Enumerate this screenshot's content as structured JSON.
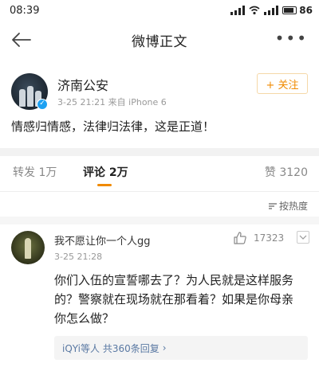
{
  "status_bar": {
    "time": "08:39",
    "battery": "86"
  },
  "nav": {
    "title": "微博正文"
  },
  "post": {
    "author": "济南公安",
    "meta": "3-25 21:21  来自 iPhone 6",
    "follow_label": "+ 关注",
    "text": "情感归情感，法律归法律，这是正道！"
  },
  "tabs": {
    "repost": "转发 1万",
    "comment": "评论 2万",
    "like": "赞 3120"
  },
  "sort_label": "按热度",
  "comment": {
    "author": "我不愿让你一个人gg",
    "time": "3-25 21:28",
    "likes": "17323",
    "text": "你们入伍的宣誓哪去了？为人民就是这样服务的？警察就在现场就在那看着？如果是你母亲 你怎么做？",
    "reply_summary": "iQYi等人 共360条回复"
  },
  "colors": {
    "accent": "#f08a00",
    "verified": "#1da1f2",
    "link": "#5a79a3"
  }
}
